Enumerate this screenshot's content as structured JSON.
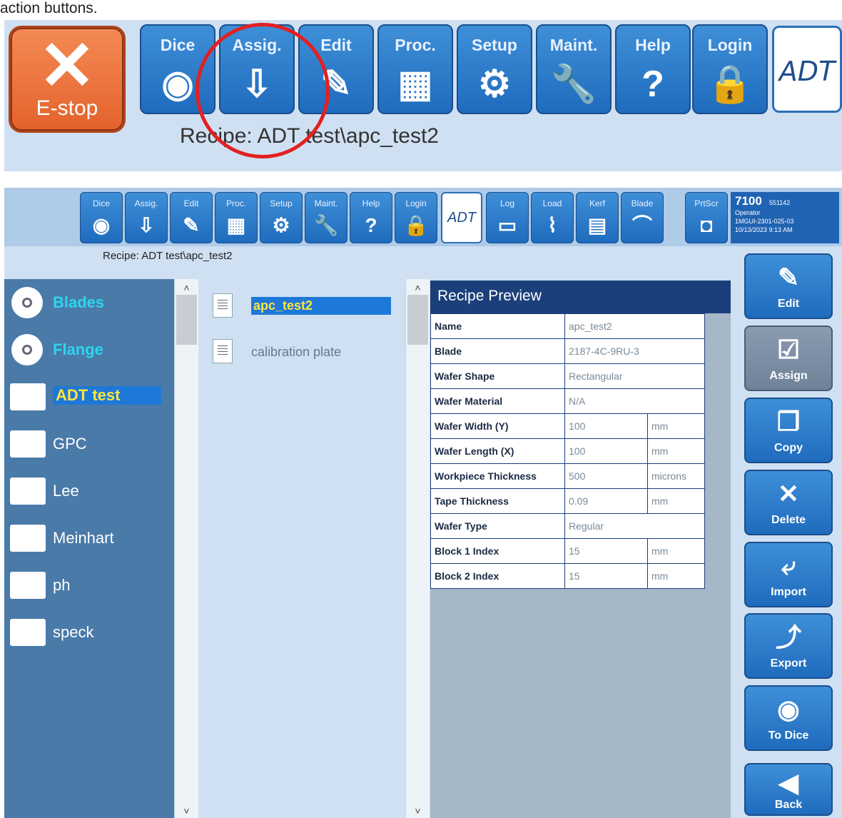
{
  "caption": "action buttons.",
  "zoom": {
    "estop_label": "E-stop",
    "buttons": [
      {
        "label": "Dice",
        "icon": "dice-icon",
        "glyph": "◉"
      },
      {
        "label": "Assig.",
        "icon": "assign-icon",
        "glyph": "⇩"
      },
      {
        "label": "Edit",
        "icon": "edit-icon",
        "glyph": "✎"
      },
      {
        "label": "Proc.",
        "icon": "process-icon",
        "glyph": "▦"
      },
      {
        "label": "Setup",
        "icon": "gear-icon",
        "glyph": "⚙"
      },
      {
        "label": "Maint.",
        "icon": "wrench-icon",
        "glyph": "🔧"
      },
      {
        "label": "Help",
        "icon": "help-icon",
        "glyph": "?"
      },
      {
        "label": "Login",
        "icon": "lock-icon",
        "glyph": "🔒"
      }
    ],
    "logo": "ADT",
    "recipe": "Recipe: ADT test\\apc_test2"
  },
  "toolbar": {
    "buttons": [
      {
        "label": "Dice",
        "glyph": "◉"
      },
      {
        "label": "Assig.",
        "glyph": "⇩"
      },
      {
        "label": "Edit",
        "glyph": "✎"
      },
      {
        "label": "Proc.",
        "glyph": "▦"
      },
      {
        "label": "Setup",
        "glyph": "⚙"
      },
      {
        "label": "Maint.",
        "glyph": "🔧"
      },
      {
        "label": "Help",
        "glyph": "?"
      },
      {
        "label": "Login",
        "glyph": "🔒"
      }
    ],
    "logo": "ADT",
    "extra_buttons": [
      {
        "label": "Log",
        "glyph": "▭"
      },
      {
        "label": "Load",
        "glyph": "⌇"
      },
      {
        "label": "Kerf",
        "glyph": "▤"
      },
      {
        "label": "Blade",
        "glyph": "⌒"
      },
      {
        "label": "PrtScr",
        "glyph": "◘"
      }
    ],
    "info": {
      "model": "7100",
      "serial": "551142",
      "role": "Operator",
      "version": "1MGUI-2301-025-03",
      "datetime": "10/13/2023 9:13 AM"
    }
  },
  "recipe_line": "Recipe: ADT test\\apc_test2",
  "folders": [
    {
      "label": "Blades"
    },
    {
      "label": "Flange"
    },
    {
      "label": "ADT test"
    },
    {
      "label": "GPC"
    },
    {
      "label": "Lee"
    },
    {
      "label": "Meinhart"
    },
    {
      "label": "ph"
    },
    {
      "label": "speck"
    }
  ],
  "recipes": [
    {
      "label": "apc_test2"
    },
    {
      "label": "calibration plate"
    }
  ],
  "preview": {
    "title": "Recipe Preview",
    "rows": [
      {
        "key": "Name",
        "value": "apc_test2",
        "unit": ""
      },
      {
        "key": "Blade",
        "value": "2187-4C-9RU-3",
        "unit": ""
      },
      {
        "key": "Wafer Shape",
        "value": "Rectangular",
        "unit": ""
      },
      {
        "key": "Wafer Material",
        "value": "N/A",
        "unit": ""
      },
      {
        "key": "Wafer Width (Y)",
        "value": "100",
        "unit": "mm"
      },
      {
        "key": "Wafer Length (X)",
        "value": "100",
        "unit": "mm"
      },
      {
        "key": "Workpiece Thickness",
        "value": "500",
        "unit": "microns"
      },
      {
        "key": "Tape Thickness",
        "value": "0.09",
        "unit": "mm"
      },
      {
        "key": "Wafer Type",
        "value": "Regular",
        "unit": ""
      },
      {
        "key": "Block 1 Index",
        "value": "15",
        "unit": "mm"
      },
      {
        "key": "Block 2 Index",
        "value": "15",
        "unit": "mm"
      }
    ]
  },
  "actions": [
    {
      "label": "Edit",
      "glyph": "✎"
    },
    {
      "label": "Assign",
      "glyph": "☑"
    },
    {
      "label": "Copy",
      "glyph": "❐"
    },
    {
      "label": "Delete",
      "glyph": "✕"
    },
    {
      "label": "Import",
      "glyph": "⤶"
    },
    {
      "label": "Export",
      "glyph": "⤴"
    },
    {
      "label": "To Dice",
      "glyph": "◉"
    },
    {
      "label": "Back",
      "glyph": "◀"
    }
  ],
  "colors": {
    "accent": "#1e78d8",
    "selected_text": "#ffe43c",
    "highlight_text": "#2cd5ee",
    "estop": "#e4622c"
  }
}
